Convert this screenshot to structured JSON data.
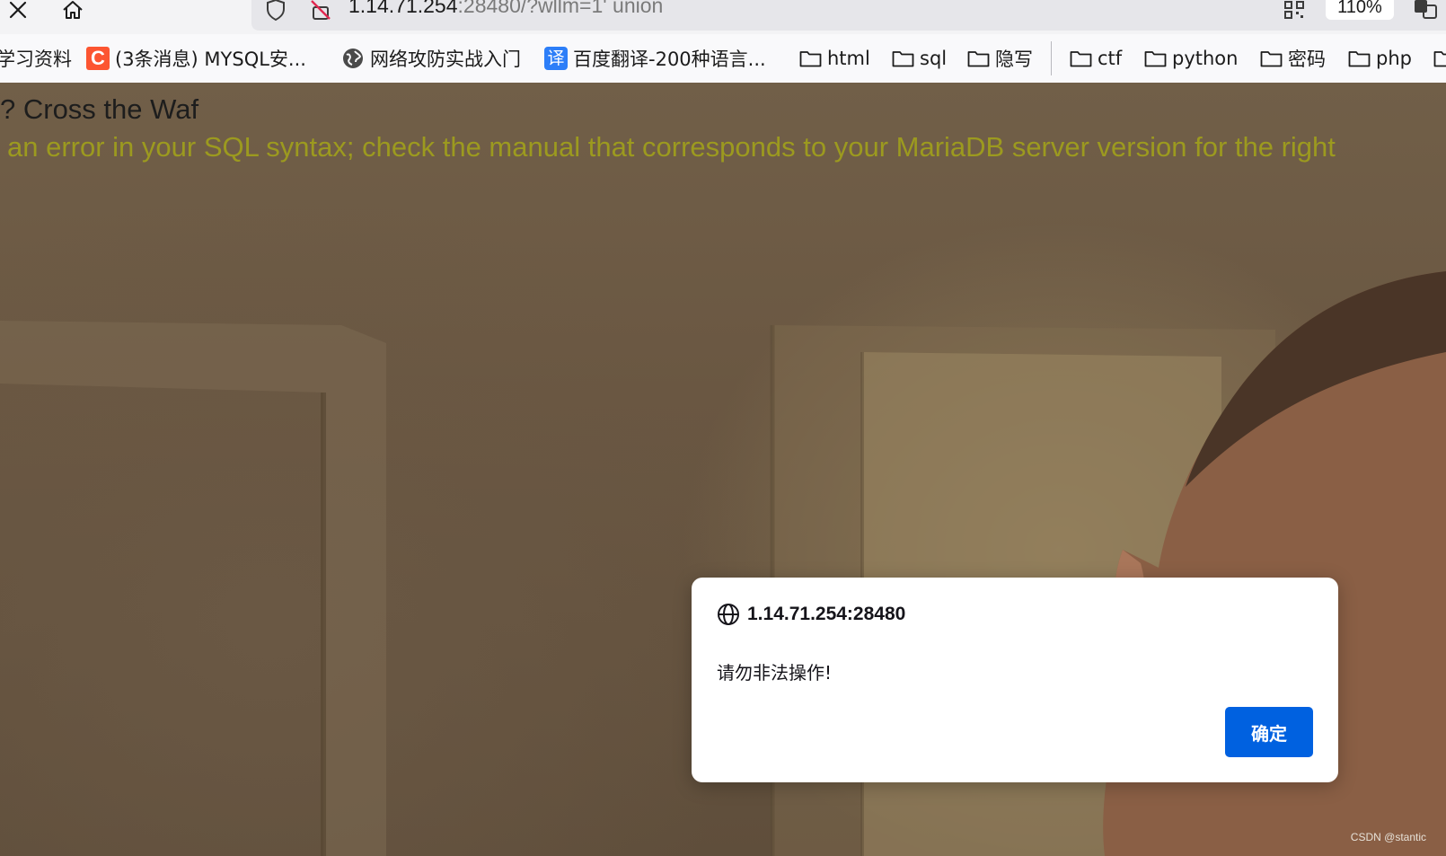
{
  "toolbar": {
    "url_host": "1.14.71.254",
    "url_rest": ":28480/?wllm=1' union",
    "zoom": "110%"
  },
  "bookmarks": [
    {
      "label": "学习资料",
      "icon": "none"
    },
    {
      "label": "(3条消息) MYSQL安...",
      "icon": "csdn-c-icon"
    },
    {
      "label": "网络攻防实战入门",
      "icon": "globe-icon"
    },
    {
      "label": "百度翻译-200种语言...",
      "icon": "baidu-translate-icon"
    },
    {
      "label": "html",
      "icon": "folder-icon"
    },
    {
      "label": "sql",
      "icon": "folder-icon"
    },
    {
      "label": "隐写",
      "icon": "folder-icon"
    },
    {
      "label": "ctf",
      "icon": "folder-icon"
    },
    {
      "label": "python",
      "icon": "folder-icon"
    },
    {
      "label": "密码",
      "icon": "folder-icon"
    },
    {
      "label": "php",
      "icon": "folder-icon"
    }
  ],
  "page": {
    "title": "? Cross the Waf",
    "error": "an error in your SQL syntax; check the manual that corresponds to your MariaDB server version for the right"
  },
  "dialog": {
    "origin": "1.14.71.254:28480",
    "message": "请勿非法操作!",
    "ok_label": "确定"
  },
  "watermark": "CSDN @stantic",
  "colors": {
    "accent": "#0061e0",
    "error_text": "#9c9a1f",
    "csdn": "#fc5531",
    "baidu_translate": "#2c7ef8"
  }
}
